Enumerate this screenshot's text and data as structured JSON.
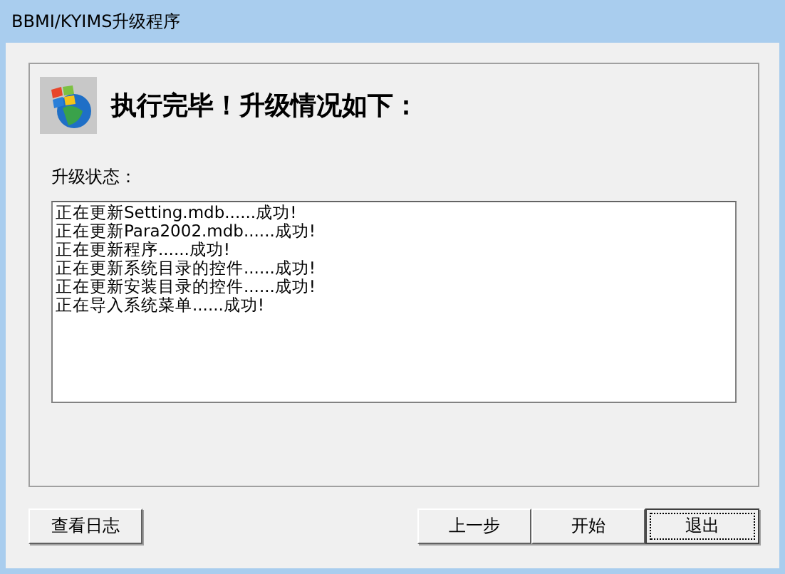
{
  "window": {
    "title": "BBMI/KYIMS升级程序"
  },
  "heading": "执行完毕！升级情况如下：",
  "status_label": "升级状态：",
  "log_lines": [
    "正在更新Setting.mdb......成功!",
    "正在更新Para2002.mdb......成功!",
    "正在更新程序......成功!",
    "正在更新系统目录的控件......成功!",
    "正在更新安装目录的控件......成功!",
    "正在导入系统菜单......成功!"
  ],
  "left_buttons": [
    {
      "label": "查看日志",
      "focused": false
    }
  ],
  "right_buttons": [
    {
      "label": "上一步",
      "focused": false
    },
    {
      "label": "开始",
      "focused": false
    },
    {
      "label": "退出",
      "focused": true
    }
  ]
}
